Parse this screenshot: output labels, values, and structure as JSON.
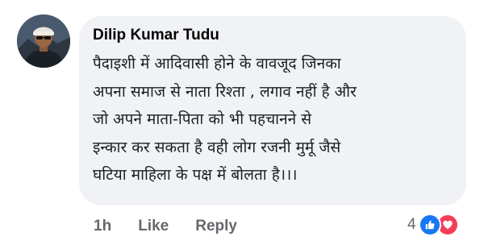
{
  "comment": {
    "author": "Dilip Kumar Tudu",
    "text_lines": [
      "पैदाइशी में आदिवासी होने के वावजूद जिनका",
      "अपना समाज से नाता रिश्ता , लगाव नहीं है और",
      "जो  अपने माता-पिता  को भी पहचानने से",
      "इन्कार कर सकता है वही  लोग रजनी मुर्मू जैसे",
      "घटिया माहिला के पक्ष में बोलता है।।।"
    ],
    "timestamp": "1h",
    "like_label": "Like",
    "reply_label": "Reply",
    "reaction_count": "4",
    "reaction_icons": [
      "like-icon",
      "love-icon"
    ]
  },
  "colors": {
    "bubble_bg": "#f0f2f5",
    "meta_text": "#65676b",
    "like_blue": "#1877f2",
    "love_red": "#f33e58"
  }
}
